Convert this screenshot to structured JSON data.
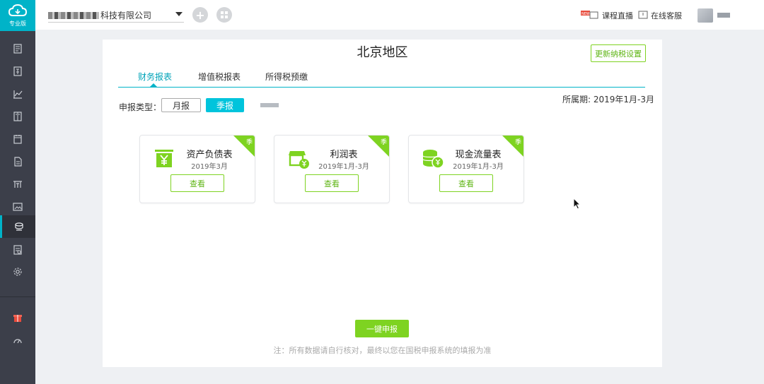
{
  "sidebar": {
    "brand_label": "专业版",
    "items": [
      {
        "icon": "ledger-icon"
      },
      {
        "icon": "voucher-icon"
      },
      {
        "icon": "chart-icon"
      },
      {
        "icon": "book-icon"
      },
      {
        "icon": "calendar-icon"
      },
      {
        "icon": "report-icon"
      },
      {
        "icon": "tax-icon"
      },
      {
        "icon": "image-icon"
      },
      {
        "icon": "declare-icon",
        "active": true
      },
      {
        "icon": "list-icon"
      },
      {
        "icon": "settings-icon"
      },
      {
        "icon": "gift-icon"
      },
      {
        "icon": "speed-icon"
      }
    ]
  },
  "topbar": {
    "company_suffix": "科技有限公司",
    "live_course": "课程直播",
    "live_badge": "NEW",
    "online_service": "在线客服"
  },
  "main": {
    "title": "北京地区",
    "settings_button": "更新纳税设置",
    "tabs": [
      {
        "label": "财务报表",
        "active": true
      },
      {
        "label": "增值税报表"
      },
      {
        "label": "所得税预缴"
      }
    ],
    "period": "所属期: 2019年1月-3月",
    "report_type_label": "申报类型：",
    "report_types": {
      "month": "月报",
      "quarter": "季报"
    },
    "cards": [
      {
        "name": "资产负债表",
        "date": "2019年3月",
        "badge": "季",
        "button": "查看",
        "icon": "balance-sheet-icon"
      },
      {
        "name": "利润表",
        "date": "2019年1月-3月",
        "badge": "季",
        "button": "查看",
        "icon": "profit-icon"
      },
      {
        "name": "现金流量表",
        "date": "2019年1月-3月",
        "badge": "季",
        "button": "查看",
        "icon": "cash-flow-icon"
      }
    ],
    "submit_button": "一键申报",
    "note": "注：所有数据请自行核对，最终以您在国税申报系统的填报为准"
  },
  "colors": {
    "accent": "#00b3c8",
    "green": "#7ed321",
    "sidebar": "#3c3f4a"
  }
}
